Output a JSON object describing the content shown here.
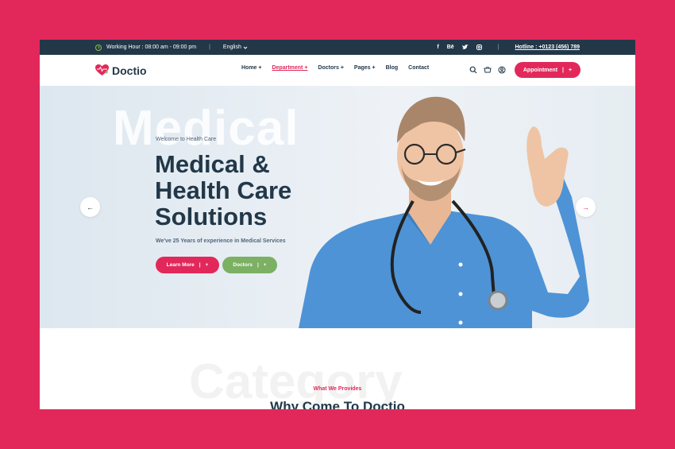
{
  "topbar": {
    "working_label": "Working Hour : 08:00 am - 09:00 pm",
    "language": "English",
    "social": [
      "f",
      "Bē",
      "t",
      "ig"
    ],
    "hotline": "Hotline : +0123 (456) 789"
  },
  "brand": {
    "name": "Doctio"
  },
  "nav": {
    "items": [
      {
        "label": "Home +"
      },
      {
        "label": "Department +"
      },
      {
        "label": "Doctors +"
      },
      {
        "label": "Pages +"
      },
      {
        "label": "Blog"
      },
      {
        "label": "Contact"
      }
    ],
    "active_index": 1,
    "appointment": "Appointment",
    "appointment_plus": "+"
  },
  "hero": {
    "ghost_word": "Medical",
    "welcome": "Welcome to Health Care",
    "headline_line1": "Medical &",
    "headline_line2": "Health Care",
    "headline_line3": "Solutions",
    "subtext": "We've 25 Years of experience in Medical Services",
    "learn_more": "Learn More",
    "doctors": "Doctors",
    "plus": "+",
    "divider": "|",
    "prev_arrow": "←",
    "next_arrow": "→"
  },
  "section": {
    "ghost_word": "Category",
    "eyebrow": "What We Provides",
    "title": "Why Come To Doctio"
  },
  "colors": {
    "accent": "#e2285a",
    "dark": "#223849",
    "green": "#7cb062"
  }
}
